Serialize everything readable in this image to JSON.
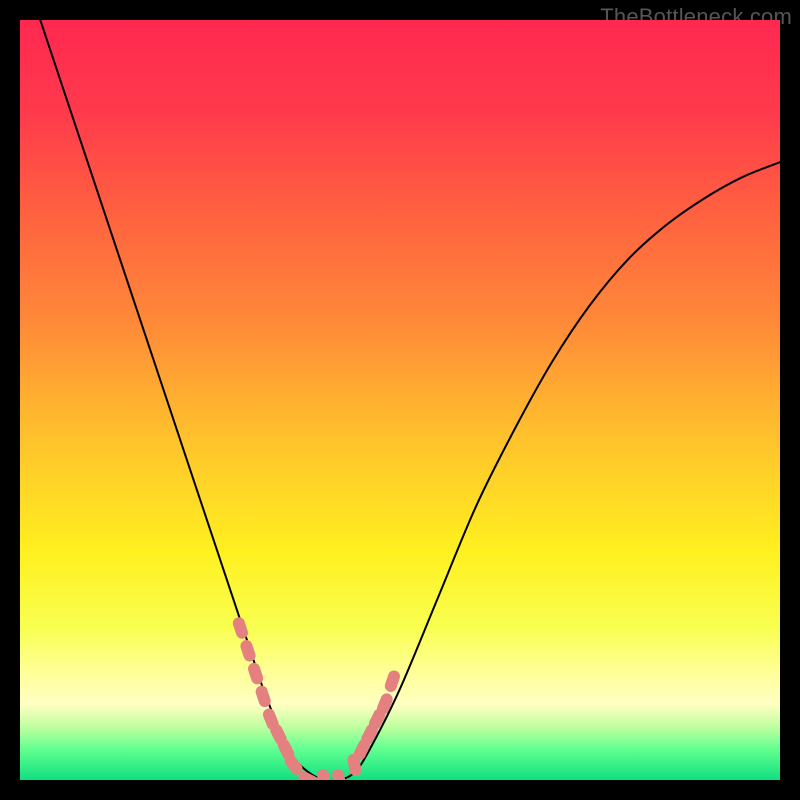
{
  "watermark": "TheBottleneck.com",
  "chart_data": {
    "type": "line",
    "title": "",
    "xlabel": "",
    "ylabel": "",
    "xlim": [
      0,
      100
    ],
    "ylim": [
      0,
      100
    ],
    "background_gradient_stops": [
      {
        "offset": 0.0,
        "color": "#ff2850"
      },
      {
        "offset": 0.12,
        "color": "#ff3a4c"
      },
      {
        "offset": 0.25,
        "color": "#ff6040"
      },
      {
        "offset": 0.4,
        "color": "#ff8a38"
      },
      {
        "offset": 0.55,
        "color": "#ffc22c"
      },
      {
        "offset": 0.7,
        "color": "#fff020"
      },
      {
        "offset": 0.8,
        "color": "#f8ff50"
      },
      {
        "offset": 0.86,
        "color": "#ffff9a"
      },
      {
        "offset": 0.9,
        "color": "#ffffc2"
      },
      {
        "offset": 0.93,
        "color": "#c0ffa0"
      },
      {
        "offset": 0.96,
        "color": "#60ff90"
      },
      {
        "offset": 1.0,
        "color": "#10e080"
      }
    ],
    "series": [
      {
        "name": "bottleneck_curve",
        "x": [
          0,
          5,
          10,
          15,
          20,
          25,
          28,
          30,
          32,
          34,
          36,
          38,
          40,
          42,
          44,
          46,
          50,
          55,
          60,
          65,
          70,
          75,
          80,
          85,
          90,
          95,
          100
        ],
        "values": [
          108,
          93,
          78,
          63,
          48,
          33,
          24,
          18,
          12,
          7,
          3,
          1,
          0,
          0,
          1,
          4,
          12,
          24,
          36,
          46,
          55,
          62.5,
          68.5,
          73,
          76.5,
          79.3,
          81.3
        ]
      }
    ],
    "highlight_points": {
      "name": "marker_points",
      "color": "#e58080",
      "x": [
        29,
        30,
        31,
        32,
        33,
        34,
        35,
        36,
        38,
        40,
        42,
        44,
        45,
        46,
        47,
        48,
        49
      ],
      "values": [
        20,
        17,
        14,
        11,
        8,
        6,
        4,
        2,
        0,
        0,
        0,
        2,
        4,
        6,
        8,
        10,
        13
      ]
    }
  }
}
